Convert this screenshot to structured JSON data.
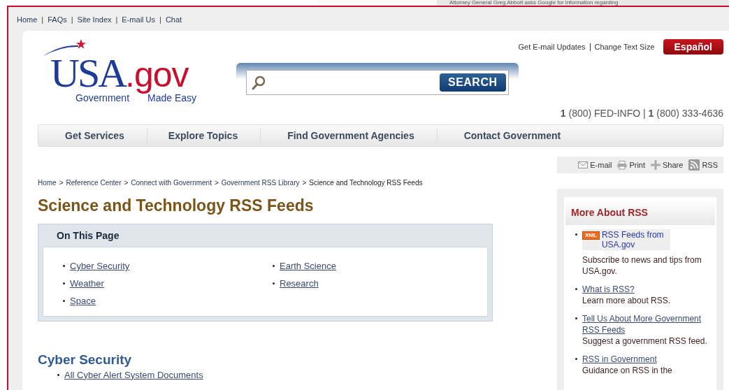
{
  "overlay_caption": "Attorney General Greg Abbott asks Google for information regarding",
  "top_links": [
    "Home",
    "FAQs",
    "Site Index",
    "E-mail Us",
    "Chat"
  ],
  "top_link_separator": "|",
  "utility_links": [
    "Get E-mail Updates",
    "Change Text Size"
  ],
  "language_button": "Español",
  "logo": {
    "mark": "USA",
    "domain": ".gov",
    "tagline_left": "Government",
    "tagline_right": "Made Easy"
  },
  "search": {
    "button": "SEARCH"
  },
  "phone": "**1** (800) FED-INFO | **1** (800) 333-4636",
  "nav": [
    "Get Services",
    "Explore Topics",
    "Find Government Agencies",
    "Contact Government"
  ],
  "share_tools": [
    {
      "label": "E-mail",
      "kind": "email"
    },
    {
      "label": "Print",
      "kind": "print"
    },
    {
      "label": "Share",
      "kind": "share"
    },
    {
      "label": "RSS",
      "kind": "rss"
    }
  ],
  "breadcrumb": [
    "Home",
    "Reference Center",
    "Connect with Government",
    "Government RSS Library",
    "Science and Technology RSS Feeds"
  ],
  "breadcrumb_separator": ">",
  "title": "Science and Technology RSS Feeds",
  "on_this_page": {
    "heading": "On This Page",
    "columns": [
      [
        "Cyber Security",
        "Weather",
        "Space"
      ],
      [
        "Earth Science",
        "Research"
      ]
    ]
  },
  "sections": [
    {
      "heading": "Cyber Security",
      "links": [
        "All Cyber Alert System Documents"
      ]
    }
  ],
  "sidebar": {
    "heading": "More About RSS",
    "items": [
      {
        "kind": "badge",
        "badge": "XML",
        "link": "RSS Feeds from USA.gov",
        "text": "Subscribe to news and tips from USA.gov."
      },
      {
        "kind": "link",
        "link": "What is RSS?",
        "text": "Learn more about RSS."
      },
      {
        "kind": "link",
        "link": "Tell Us About More Government RSS Feeds",
        "text": "Suggest a government RSS feed."
      },
      {
        "kind": "link",
        "link": "RSS in Government",
        "text": "Guidance on RSS in the"
      }
    ]
  }
}
